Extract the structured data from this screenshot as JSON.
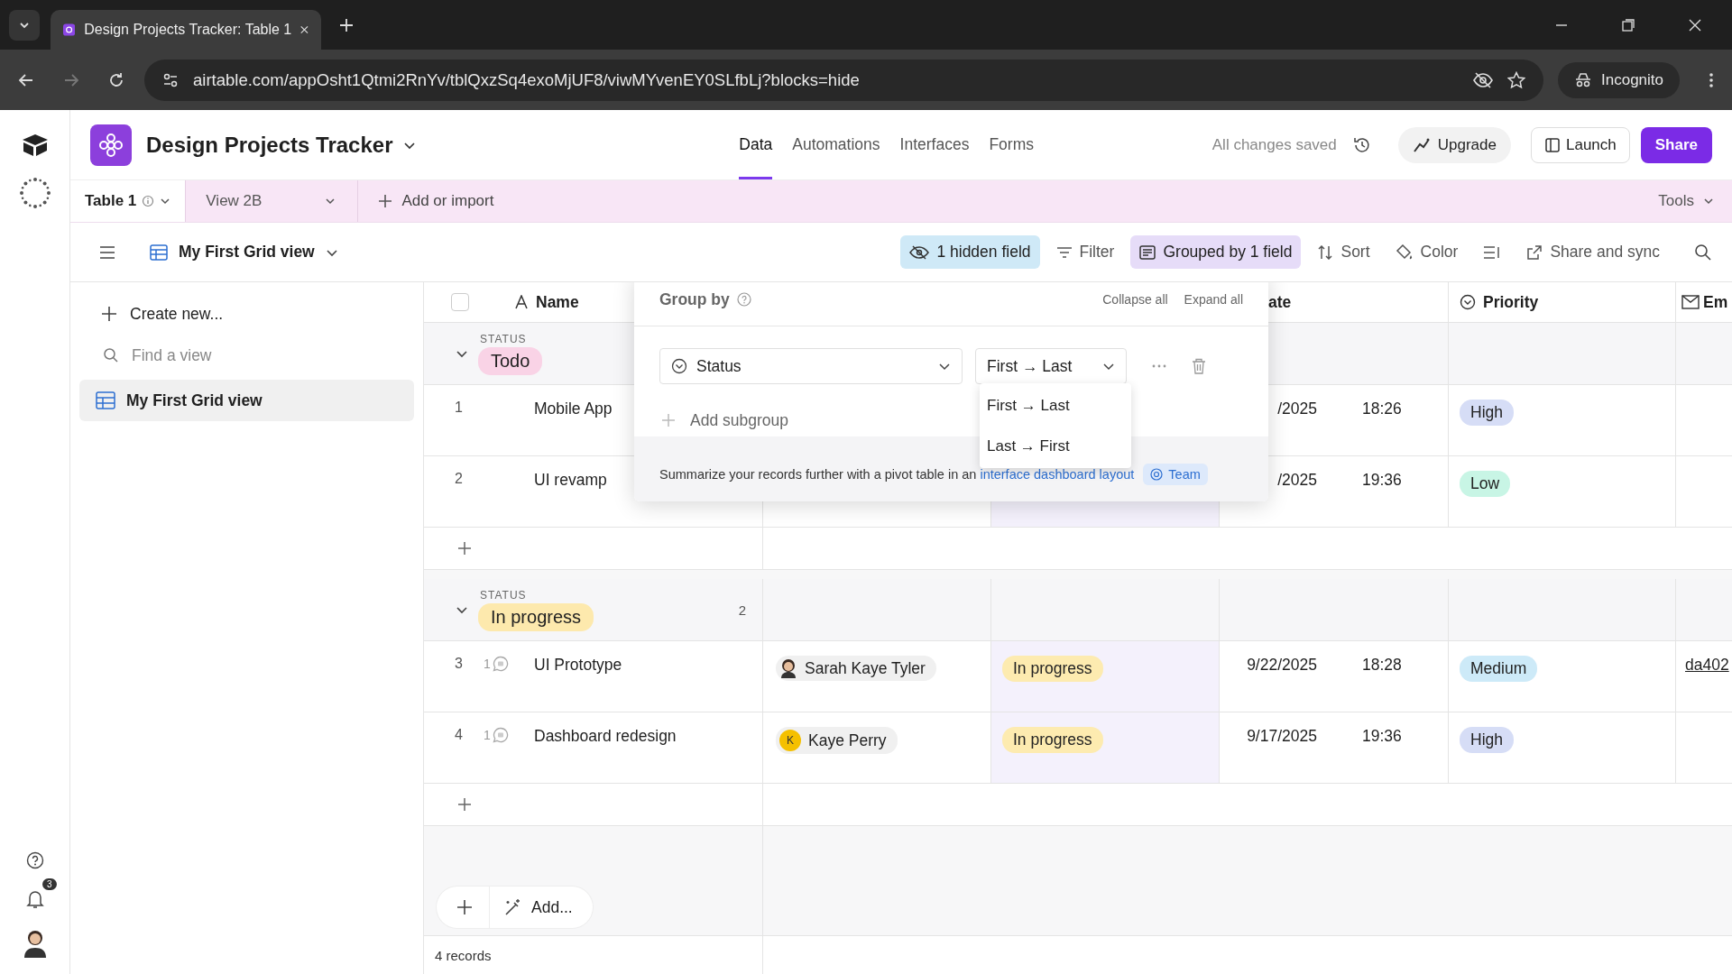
{
  "browser": {
    "tab_title": "Design Projects Tracker: Table 1",
    "url": "airtable.com/appOsht1Qtmi2RnYv/tblQxzSq4exoMjUF8/viwMYvenEY0SLfbLj?blocks=hide",
    "profile": "Incognito"
  },
  "app": {
    "title": "Design Projects Tracker",
    "nav_tabs": [
      {
        "label": "Data",
        "selected": true
      },
      {
        "label": "Automations",
        "selected": false
      },
      {
        "label": "Interfaces",
        "selected": false
      },
      {
        "label": "Forms",
        "selected": false
      }
    ],
    "save_status": "All changes saved",
    "upgrade": "Upgrade",
    "launch": "Launch",
    "share": "Share"
  },
  "table_bar": {
    "tabs": [
      {
        "label": "Table 1",
        "selected": true
      },
      {
        "label": "View 2B",
        "selected": false
      }
    ],
    "add": "Add or import",
    "tools": "Tools"
  },
  "toolbar": {
    "view_name": "My First Grid view",
    "actions": [
      {
        "kind": "hidden",
        "label": "1 hidden field",
        "active": true
      },
      {
        "kind": "filter",
        "label": "Filter",
        "active": false
      },
      {
        "kind": "group",
        "label": "Grouped by 1 field",
        "active": true
      },
      {
        "kind": "sort",
        "label": "Sort",
        "active": false
      },
      {
        "kind": "color",
        "label": "Color",
        "active": false
      },
      {
        "kind": "rowheight",
        "active": false
      },
      {
        "kind": "share",
        "label": "Share and sync",
        "active": false
      }
    ]
  },
  "rail": {
    "notifications": "3"
  },
  "sidebar": {
    "create": "Create new...",
    "search_placeholder": "Find a view",
    "views": [
      {
        "label": "My First Grid view",
        "selected": true
      }
    ]
  },
  "grid": {
    "select_all_checked": false,
    "columns": [
      {
        "kind": "text",
        "label": "Name"
      },
      {
        "kind": "hidden"
      },
      {
        "kind": "hidden"
      },
      {
        "kind": "plain",
        "label": "ate"
      },
      {
        "kind": "select",
        "label": "Priority"
      },
      {
        "kind": "email",
        "label": "Em"
      }
    ],
    "groups": [
      {
        "field": "STATUS",
        "value": "Todo",
        "color": "#f9d3e6",
        "expanded": true,
        "rows": [
          {
            "number": "1",
            "name": "Mobile App",
            "date": "/2025",
            "time": "18:26",
            "priority": {
              "label": "High",
              "color": "#d6ddf6"
            }
          },
          {
            "number": "2",
            "name": "UI revamp",
            "date": "/2025",
            "time": "19:36",
            "priority": {
              "label": "Low",
              "color": "#c8f5e5"
            }
          }
        ]
      },
      {
        "field": "STATUS",
        "value": "In progress",
        "color": "#fde9ad",
        "count": "2",
        "expanded": true,
        "rows": [
          {
            "number": "3",
            "comments": "1",
            "name": "UI Prototype",
            "assignee": {
              "kind": "photo",
              "name": "Sarah Kaye Tyler"
            },
            "status": {
              "label": "In progress",
              "color": "#fdebb0"
            },
            "date": "9/22/2025",
            "time": "18:28",
            "priority": {
              "label": "Medium",
              "color": "#cdeaf8"
            },
            "email": "da402"
          },
          {
            "number": "4",
            "comments": "1",
            "name": "Dashboard redesign",
            "assignee": {
              "kind": "initial",
              "initial": "K",
              "name": "Kaye Perry"
            },
            "status": {
              "label": "In progress",
              "color": "#fdebb0"
            },
            "date": "9/17/2025",
            "time": "19:36",
            "priority": {
              "label": "High",
              "color": "#d6ddf6"
            }
          }
        ]
      }
    ],
    "add_label": "Add...",
    "records": "4 records"
  },
  "popover": {
    "title": "Group by",
    "collapse": "Collapse all",
    "expand": "Expand all",
    "field": "Status",
    "order": "First → Last",
    "add_subgroup": "Add subgroup",
    "footer_text": "Summarize your records further with a pivot table in an",
    "footer_link": "interface dashboard layout",
    "badge": "Team",
    "menu": [
      {
        "label": "First → Last"
      },
      {
        "label": "Last → First"
      }
    ]
  }
}
